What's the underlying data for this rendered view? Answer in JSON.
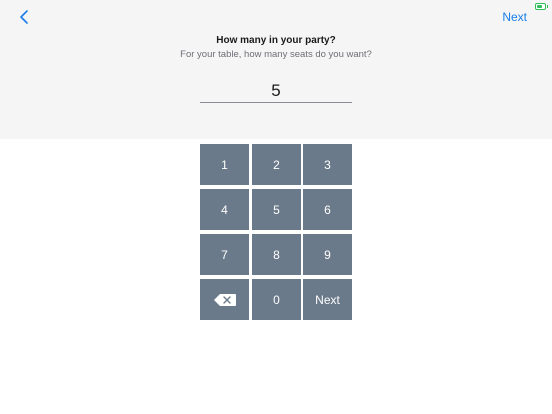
{
  "header": {
    "next_label": "Next",
    "back_icon": "chevron-left-icon"
  },
  "prompt": {
    "title": "How many in your party?",
    "subtitle": "For your table, how many seats do you want?"
  },
  "input": {
    "value": "5"
  },
  "keypad": {
    "keys": [
      "1",
      "2",
      "3",
      "4",
      "5",
      "6",
      "7",
      "8",
      "9"
    ],
    "zero": "0",
    "next_label": "Next",
    "delete_icon": "backspace-icon"
  },
  "colors": {
    "accent": "#1a7ee6",
    "key_background": "#6b7a8a",
    "panel_background": "#f5f5f6",
    "battery": "#2fbf5a"
  }
}
